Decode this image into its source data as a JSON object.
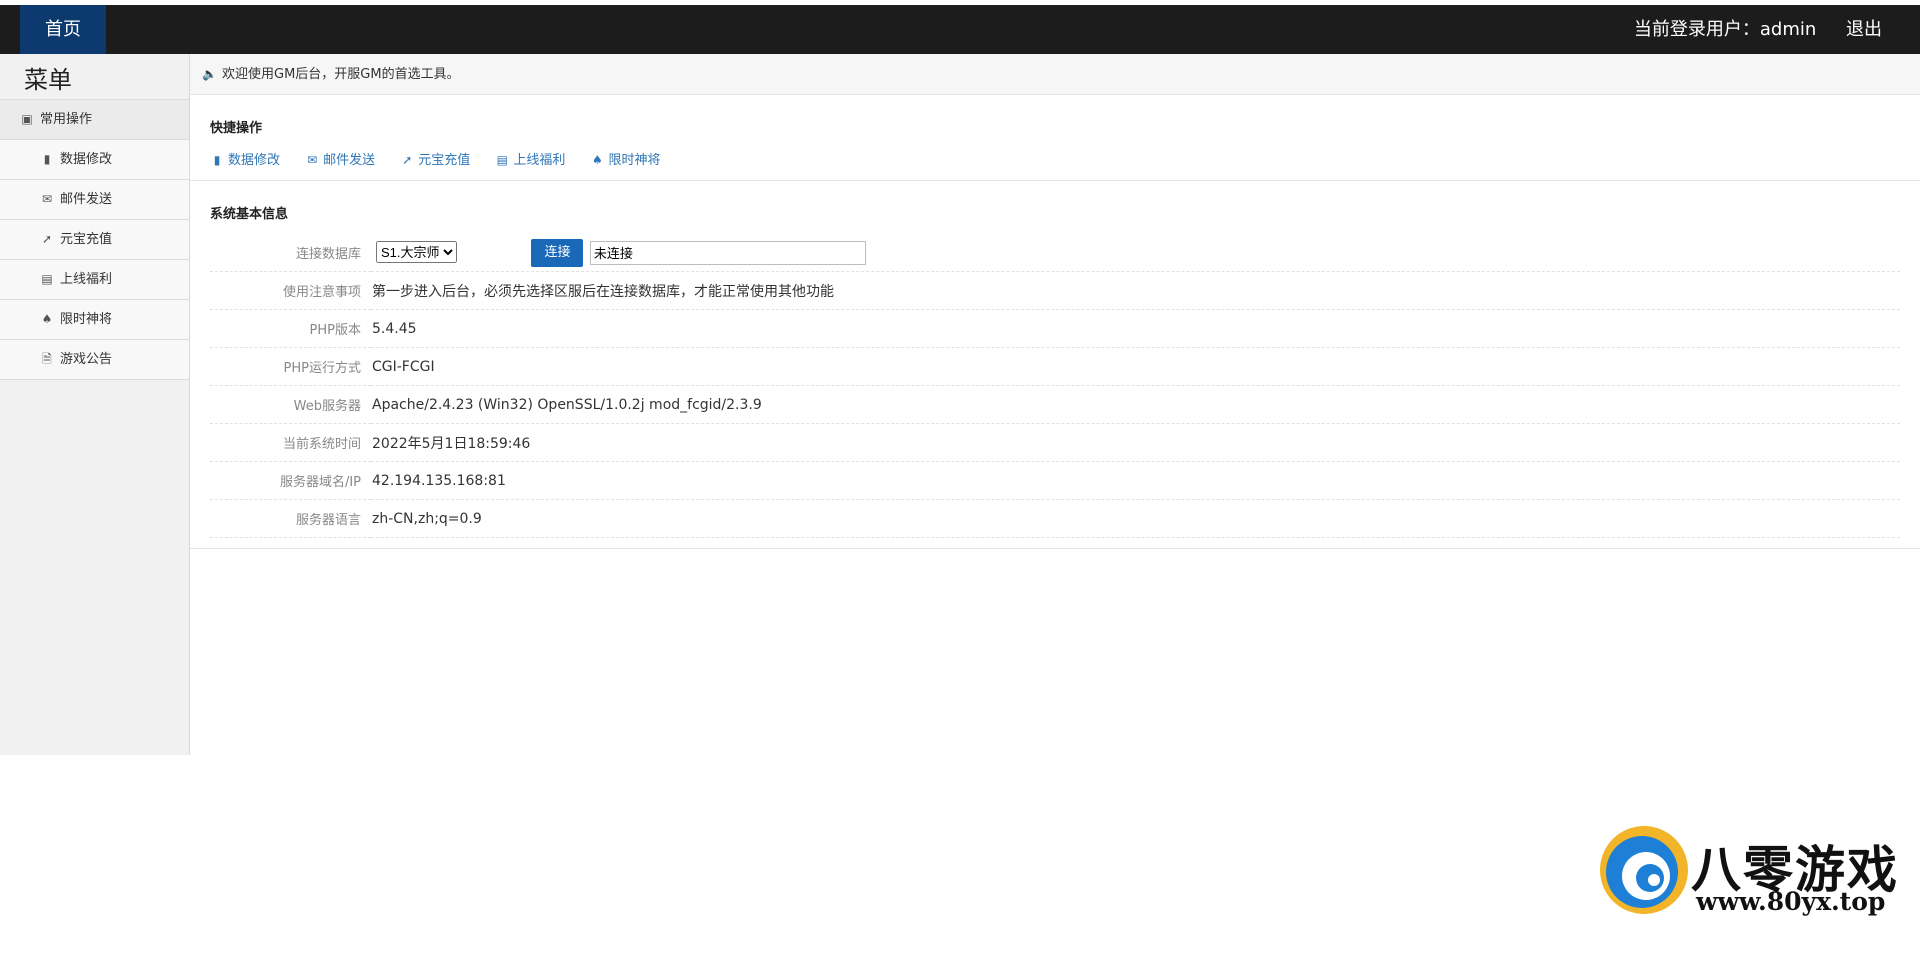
{
  "topbar": {
    "home_label": "首页",
    "user_label": "当前登录用户：admin",
    "logout_label": "退出"
  },
  "sidebar": {
    "title": "菜单",
    "group_label": "常用操作",
    "items": [
      {
        "label": "数据修改",
        "icon": "books-icon"
      },
      {
        "label": "邮件发送",
        "icon": "envelope-icon"
      },
      {
        "label": "元宝充值",
        "icon": "plug-icon"
      },
      {
        "label": "上线福利",
        "icon": "list-icon"
      },
      {
        "label": "限时神将",
        "icon": "spade-icon"
      },
      {
        "label": "游戏公告",
        "icon": "file-icon"
      }
    ]
  },
  "main": {
    "welcome": "欢迎使用GM后台，开服GM的首选工具。",
    "quick": {
      "title": "快捷操作",
      "links": [
        "数据修改",
        "邮件发送",
        "元宝充值",
        "上线福利",
        "限时神将"
      ]
    },
    "sysinfo": {
      "title": "系统基本信息",
      "db_label": "连接数据库",
      "db_selected": "S1.大宗师",
      "connect_label": "连接",
      "connect_status": "未连接",
      "rows": [
        {
          "label": "使用注意事项",
          "value": "第一步进入后台，必须先选择区服后在连接数据库，才能正常使用其他功能"
        },
        {
          "label": "PHP版本",
          "value": "5.4.45"
        },
        {
          "label": "PHP运行方式",
          "value": "CGI-FCGI"
        },
        {
          "label": "Web服务器",
          "value": "Apache/2.4.23 (Win32) OpenSSL/1.0.2j mod_fcgid/2.3.9"
        },
        {
          "label": "当前系统时间",
          "value": "2022年5月1日18:59:46"
        },
        {
          "label": "服务器域名/IP",
          "value": "42.194.135.168:81"
        },
        {
          "label": "服务器语言",
          "value": "zh-CN,zh;q=0.9"
        }
      ]
    }
  },
  "watermark": {
    "name": "八零游戏",
    "url": "www.80yx.top"
  },
  "colors": {
    "topbar": "#1c1c1c",
    "home_active": "#0d3a6e",
    "link": "#2f76b6",
    "button": "#1a68b8"
  }
}
